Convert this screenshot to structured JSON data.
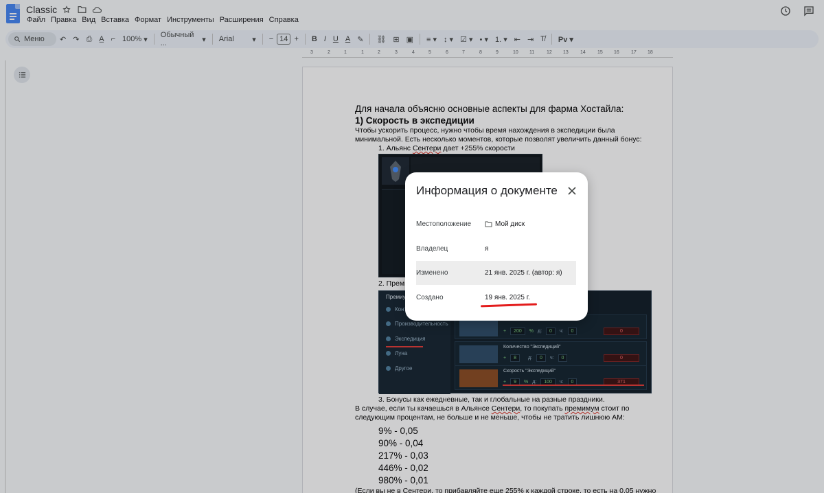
{
  "app": {
    "title": "Classic",
    "menu": [
      "Файл",
      "Правка",
      "Вид",
      "Вставка",
      "Формат",
      "Инструменты",
      "Расширения",
      "Справка"
    ]
  },
  "toolbar": {
    "search_label": "Меню",
    "zoom": "100%",
    "style": "Обычный ...",
    "font": "Arial",
    "font_size": "14",
    "minus": "−",
    "plus": "+"
  },
  "ruler": {
    "ticks": [
      "3",
      "2",
      "1",
      "1",
      "2",
      "3",
      "4",
      "5",
      "6",
      "7",
      "8",
      "9",
      "10",
      "11",
      "12",
      "13",
      "14",
      "15",
      "16",
      "17",
      "18"
    ]
  },
  "document": {
    "intro": "Для начала объясню основные аспекты для фарма Хостайла:",
    "heading1": "1) Скорость в экспедиции",
    "para1": "Чтобы ускорить процесс, нужно чтобы время нахождения в экспедиции была минимальной. Есть несколько моментов, которые позволят увеличить данный бонус:",
    "item1_prefix": "1. Альянс ",
    "item1_link": "Сентери",
    "item1_suffix": " дает +255% скорости",
    "item2": "2. Преми",
    "item3": "3. Бонусы как ежедневные, так и глобальные на разные праздники.",
    "para2_a": "В случае, если ты качаешься в Альянсе ",
    "para2_link1": "Сентери",
    "para2_b": ", то покупать ",
    "para2_link2": "премимум",
    "para2_c": " стоит по следующим процентам, не больше и не меньше, чтобы не тратить лишнюю АМ:",
    "percents": [
      "9% - 0,05",
      "90% - 0,04",
      "217% - 0,03",
      "446% - 0,02",
      "980% - 0,01"
    ],
    "footer_a": "(Если вы не в ",
    "footer_link": "Сентери",
    "footer_b": ", то прибавляйте еще 255% к каждой строке, то есть на 0.05 нужно -"
  },
  "game_screenshot": {
    "menu_items": [
      "Конт",
      "Производительность",
      "Экспедиция",
      "Луна",
      "Другое"
    ],
    "header": "Премиу",
    "rows": [
      {
        "title": "",
        "value": "200",
        "unit": "%",
        "d": "0",
        "ch": "0",
        "count": "0"
      },
      {
        "title": "Количество \"Экспедиций\"",
        "value": "8",
        "unit": "",
        "d": "0",
        "ch": "0",
        "count": "0"
      },
      {
        "title": "Скорость \"Экспедиций\"",
        "value": "9",
        "unit": "%",
        "d": "100",
        "ch": "0",
        "count": "371"
      }
    ],
    "labels": {
      "plus": "+",
      "d": "д:",
      "ch": "ч:"
    }
  },
  "dialog": {
    "title": "Информация о документе",
    "rows": [
      {
        "key": "Местоположение",
        "value": "Мой диск"
      },
      {
        "key": "Владелец",
        "value": "я"
      },
      {
        "key": "Изменено",
        "value": "21 янв. 2025 г. (автор: я)"
      },
      {
        "key": "Создано",
        "value": "19 янв. 2025 г."
      }
    ]
  },
  "colors": {
    "accent": "#4285f4",
    "highlight": "#e31c1c",
    "toolbar_bg": "#edf2fa"
  }
}
